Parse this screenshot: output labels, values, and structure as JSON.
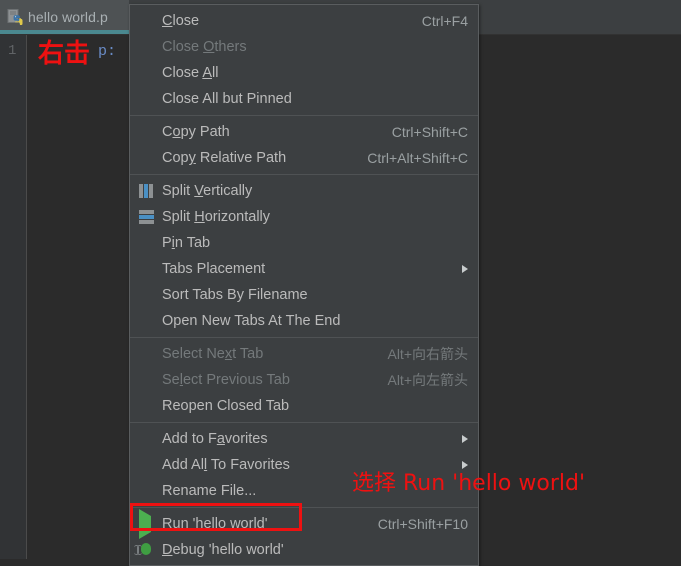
{
  "editor": {
    "tab": {
      "filename": "hello world.p",
      "icon": "python-file-icon"
    },
    "line_number": "1",
    "code_fragment": "p:"
  },
  "annotations": {
    "right_click": "右击",
    "choose_run": "选择 Run 'hello world'"
  },
  "colors": {
    "annotation_red": "#ee1111",
    "menu_background": "#3c3f41",
    "tab_active_underline": "#4a888f",
    "run_green": "#4caf50"
  },
  "context_menu": {
    "groups": [
      {
        "items": [
          {
            "label": "Close",
            "mnemonic": "C",
            "shortcut": "Ctrl+F4",
            "icon": null,
            "disabled": false,
            "submenu": false
          },
          {
            "label": "Close Others",
            "mnemonic": "O",
            "shortcut": "",
            "icon": null,
            "disabled": true,
            "submenu": false
          },
          {
            "label": "Close All",
            "mnemonic": "A",
            "shortcut": "",
            "icon": null,
            "disabled": false,
            "submenu": false
          },
          {
            "label": "Close All but Pinned",
            "mnemonic": "",
            "shortcut": "",
            "icon": null,
            "disabled": false,
            "submenu": false
          }
        ]
      },
      {
        "items": [
          {
            "label": "Copy Path",
            "mnemonic": "o",
            "shortcut": "Ctrl+Shift+C",
            "icon": null,
            "disabled": false,
            "submenu": false
          },
          {
            "label": "Copy Relative Path",
            "mnemonic": "y",
            "shortcut": "Ctrl+Alt+Shift+C",
            "icon": null,
            "disabled": false,
            "submenu": false
          }
        ]
      },
      {
        "items": [
          {
            "label": "Split Vertically",
            "mnemonic": "V",
            "shortcut": "",
            "icon": "split-vertically-icon",
            "disabled": false,
            "submenu": false
          },
          {
            "label": "Split Horizontally",
            "mnemonic": "H",
            "shortcut": "",
            "icon": "split-horizontally-icon",
            "disabled": false,
            "submenu": false
          },
          {
            "label": "Pin Tab",
            "mnemonic": "i",
            "shortcut": "",
            "icon": null,
            "disabled": false,
            "submenu": false
          },
          {
            "label": "Tabs Placement",
            "mnemonic": "",
            "shortcut": "",
            "icon": null,
            "disabled": false,
            "submenu": true
          },
          {
            "label": "Sort Tabs By Filename",
            "mnemonic": "",
            "shortcut": "",
            "icon": null,
            "disabled": false,
            "submenu": false
          },
          {
            "label": "Open New Tabs At The End",
            "mnemonic": "",
            "shortcut": "",
            "icon": null,
            "disabled": false,
            "submenu": false
          }
        ]
      },
      {
        "items": [
          {
            "label": "Select Next Tab",
            "mnemonic": "x",
            "shortcut": "Alt+向右箭头",
            "icon": null,
            "disabled": true,
            "submenu": false
          },
          {
            "label": "Select Previous Tab",
            "mnemonic": "l",
            "shortcut": "Alt+向左箭头",
            "icon": null,
            "disabled": true,
            "submenu": false
          },
          {
            "label": "Reopen Closed Tab",
            "mnemonic": "",
            "shortcut": "",
            "icon": null,
            "disabled": false,
            "submenu": false
          }
        ]
      },
      {
        "items": [
          {
            "label": "Add to Favorites",
            "mnemonic": "a",
            "shortcut": "",
            "icon": null,
            "disabled": false,
            "submenu": true
          },
          {
            "label": "Add All To Favorites",
            "mnemonic": "l",
            "shortcut": "",
            "icon": null,
            "disabled": false,
            "submenu": true
          },
          {
            "label": "Rename File...",
            "mnemonic": "",
            "shortcut": "",
            "icon": null,
            "disabled": false,
            "submenu": false
          }
        ]
      },
      {
        "items": [
          {
            "label": "Run 'hello world'",
            "mnemonic": "u",
            "shortcut": "Ctrl+Shift+F10",
            "icon": "run-icon",
            "disabled": false,
            "submenu": false
          },
          {
            "label": "Debug 'hello world'",
            "mnemonic": "D",
            "shortcut": "",
            "icon": "debug-icon",
            "disabled": false,
            "submenu": false
          }
        ]
      }
    ]
  }
}
